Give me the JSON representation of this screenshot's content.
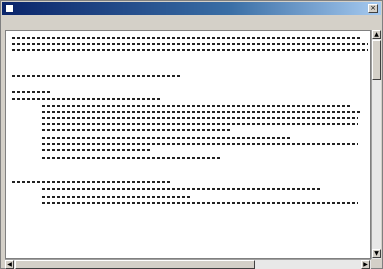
{
  "window": {
    "title": "",
    "icon": "notepad-icon"
  },
  "menubar": {
    "items": []
  },
  "document": {
    "lines": []
  },
  "scrollbars": {
    "vertical": true,
    "horizontal": true
  }
}
